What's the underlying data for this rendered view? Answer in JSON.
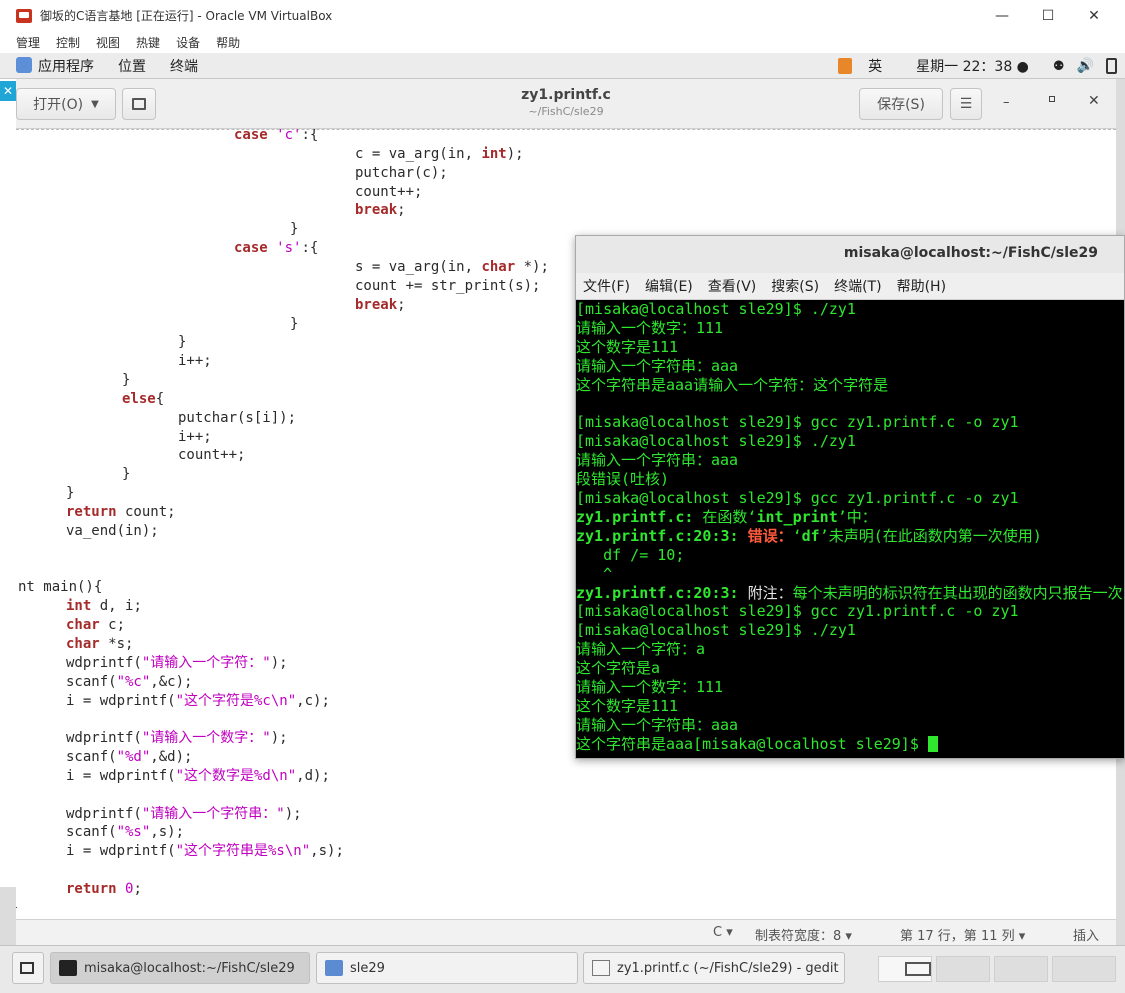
{
  "vbox": {
    "title": "御坂的C语言基地 [正在运行] - Oracle VM VirtualBox",
    "menu": [
      "管理",
      "控制",
      "视图",
      "热键",
      "设备",
      "帮助"
    ],
    "controls": {
      "minimize": "—",
      "maximize": "☐",
      "close": "✕"
    }
  },
  "topbar": {
    "apps": "应用程序",
    "places": "位置",
    "terminal": "终端",
    "ime": "英",
    "clock": "星期一 22：38 ●"
  },
  "gedit": {
    "open_label": "打开(O)",
    "save_label": "保存(S)",
    "title": "zy1.printf.c",
    "subtitle": "~/FishC/sle29",
    "code": [
      {
        "indent": 218,
        "html": "<span class=\"k\">case</span> <span class=\"s\">'c'</span>:{"
      },
      {
        "indent": 339,
        "html": "c = va_arg(in, <span class=\"k\">int</span>);"
      },
      {
        "indent": 339,
        "html": "putchar(c);"
      },
      {
        "indent": 339,
        "html": "count++;"
      },
      {
        "indent": 339,
        "html": "<span class=\"k\">break</span>;"
      },
      {
        "indent": 274,
        "html": "}"
      },
      {
        "indent": 218,
        "html": "<span class=\"k\">case</span> <span class=\"s\">'s'</span>:{"
      },
      {
        "indent": 339,
        "html": "s = va_arg(in, <span class=\"k\">char</span> *);"
      },
      {
        "indent": 339,
        "html": "count += str_print(s);"
      },
      {
        "indent": 339,
        "html": "<span class=\"k\">break</span>;"
      },
      {
        "indent": 274,
        "html": "}"
      },
      {
        "indent": 162,
        "html": "}"
      },
      {
        "indent": 162,
        "html": "i++;"
      },
      {
        "indent": 106,
        "html": "}"
      },
      {
        "indent": 106,
        "html": "<span class=\"k\">else</span>{"
      },
      {
        "indent": 162,
        "html": "putchar(s[i]);"
      },
      {
        "indent": 162,
        "html": "i++;"
      },
      {
        "indent": 162,
        "html": "count++;"
      },
      {
        "indent": 106,
        "html": "}"
      },
      {
        "indent": 50,
        "html": "}"
      },
      {
        "indent": 50,
        "html": "<span class=\"k\">return</span> count;"
      },
      {
        "indent": 50,
        "html": "va_end(in);"
      },
      {
        "indent": 0,
        "html": ""
      },
      {
        "indent": 0,
        "html": ""
      },
      {
        "indent": 2,
        "html": "nt main(){"
      },
      {
        "indent": 50,
        "html": "<span class=\"k\">int</span> d, i;"
      },
      {
        "indent": 50,
        "html": "<span class=\"k\">char</span> c;"
      },
      {
        "indent": 50,
        "html": "<span class=\"k\">char</span> *s;"
      },
      {
        "indent": 50,
        "html": "wdprintf(<span class=\"s\">\"请输入一个字符：\"</span>);"
      },
      {
        "indent": 50,
        "html": "scanf(<span class=\"s\">\"%c\"</span>,&amp;c);"
      },
      {
        "indent": 50,
        "html": "i = wdprintf(<span class=\"s\">\"这个字符是%c\\n\"</span>,c);"
      },
      {
        "indent": 0,
        "html": ""
      },
      {
        "indent": 50,
        "html": "wdprintf(<span class=\"s\">\"请输入一个数字：\"</span>);"
      },
      {
        "indent": 50,
        "html": "scanf(<span class=\"s\">\"%d\"</span>,&amp;d);"
      },
      {
        "indent": 50,
        "html": "i = wdprintf(<span class=\"s\">\"这个数字是%d\\n\"</span>,d);"
      },
      {
        "indent": 0,
        "html": ""
      },
      {
        "indent": 50,
        "html": "wdprintf(<span class=\"s\">\"请输入一个字符串：\"</span>);"
      },
      {
        "indent": 50,
        "html": "scanf(<span class=\"s\">\"%s\"</span>,s);"
      },
      {
        "indent": 50,
        "html": "i = wdprintf(<span class=\"s\">\"这个字符串是%s\\n\"</span>,s);"
      },
      {
        "indent": 0,
        "html": ""
      },
      {
        "indent": 50,
        "html": "<span class=\"k\">return</span> <span class=\"n\">0</span>;"
      },
      {
        "indent": -6,
        "html": "}"
      }
    ],
    "status": {
      "lang": "C ▾",
      "tab_width": "制表符宽度：8 ▾",
      "position": "第 17 行，第 11 列 ▾",
      "mode": "插入"
    }
  },
  "terminal": {
    "title": "misaka@localhost:~/FishC/sle29",
    "menu": [
      "文件(F)",
      "编辑(E)",
      "查看(V)",
      "搜索(S)",
      "终端(T)",
      "帮助(H)"
    ],
    "lines": [
      "[misaka@localhost sle29]$ ./zy1",
      "请输入一个数字：111",
      "这个数字是111",
      "请输入一个字符串：aaa",
      "这个字符串是aaa请输入一个字符：这个字符是",
      "",
      "[misaka@localhost sle29]$ gcc zy1.printf.c -o zy1",
      "[misaka@localhost sle29]$ ./zy1",
      "请输入一个字符串：aaa",
      "段错误(吐核)",
      "[misaka@localhost sle29]$ gcc zy1.printf.c -o zy1",
      "<b>zy1.printf.c:</b> 在函数‘<b>int_print</b>’中：",
      "<b>zy1.printf.c:20:3:</b> <span class=\"err\">错误：</span>‘<b>df</b>’未声明(在此函数内第一次使用)",
      "   df /= 10;",
      "   ^",
      "<b>zy1.printf.c:20:3:</b> <span class=\"wh\">附注：</span>每个未声明的标识符在其出现的函数内只报告一次",
      "[misaka@localhost sle29]$ gcc zy1.printf.c -o zy1",
      "[misaka@localhost sle29]$ ./zy1",
      "请输入一个字符：a",
      "这个字符是a",
      "请输入一个数字：111",
      "这个数字是111",
      "请输入一个字符串：aaa",
      "这个字符串是aaa[misaka@localhost sle29]$ "
    ]
  },
  "taskbar": {
    "items": [
      {
        "label": "misaka@localhost:~/FishC/sle29"
      },
      {
        "label": "sle29"
      },
      {
        "label": "zy1.printf.c (~/FishC/sle29) - gedit"
      }
    ]
  },
  "colors": {
    "terminal_fg": "#2fe72f",
    "terminal_bg": "#000000",
    "keyword": "#a52a2a",
    "string": "#c000c0",
    "error": "#ff5a3c"
  }
}
